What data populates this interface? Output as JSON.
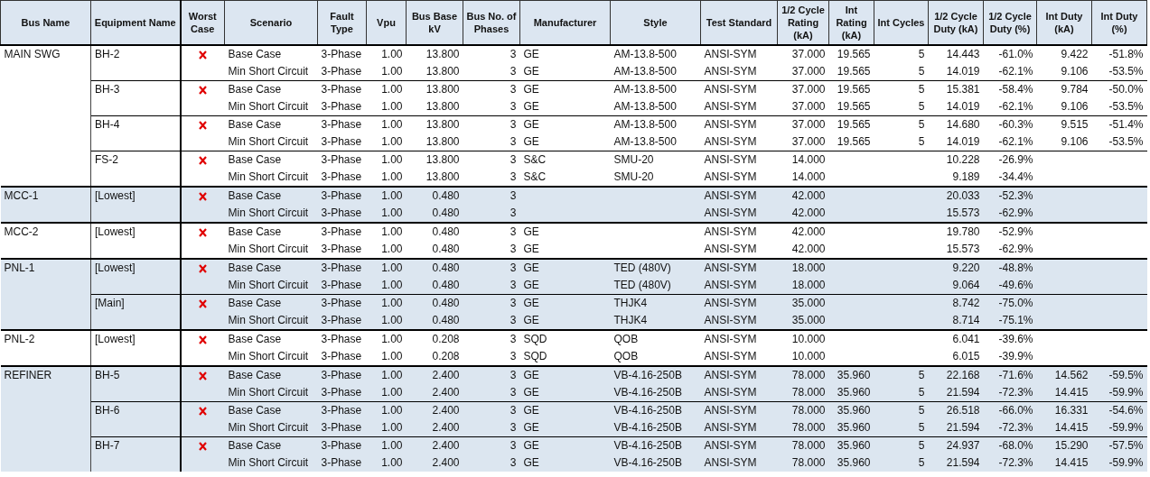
{
  "table": {
    "columns": [
      "Bus Name",
      "Equipment Name",
      "Worst Case",
      "Scenario",
      "Fault Type",
      "Vpu",
      "Bus Base kV",
      "Bus No. of Phases",
      "Manufacturer",
      "Style",
      "Test Standard",
      "1/2 Cycle Rating (kA)",
      "Int Rating (kA)",
      "Int Cycles",
      "1/2 Cycle Duty (kA)",
      "1/2 Cycle Duty (%)",
      "Int Duty (kA)",
      "Int Duty (%)"
    ],
    "buses": [
      {
        "name": "MAIN SWG",
        "equipment": [
          {
            "name": "BH-2",
            "rows": [
              {
                "worst_case": true,
                "scenario": "Base Case",
                "fault_type": "3-Phase",
                "vpu": "1.00",
                "bus_kv": "13.800",
                "phases": "3",
                "manufacturer": "GE",
                "style": "AM-13.8-500",
                "standard": "ANSI-SYM",
                "half_cycle_rating": "37.000",
                "int_rating": "19.565",
                "int_cycles": "5",
                "half_cycle_duty_ka": "14.443",
                "half_cycle_duty_pct": "-61.0%",
                "int_duty_ka": "9.422",
                "int_duty_pct": "-51.8%"
              },
              {
                "worst_case": false,
                "scenario": "Min Short Circuit",
                "fault_type": "3-Phase",
                "vpu": "1.00",
                "bus_kv": "13.800",
                "phases": "3",
                "manufacturer": "GE",
                "style": "AM-13.8-500",
                "standard": "ANSI-SYM",
                "half_cycle_rating": "37.000",
                "int_rating": "19.565",
                "int_cycles": "5",
                "half_cycle_duty_ka": "14.019",
                "half_cycle_duty_pct": "-62.1%",
                "int_duty_ka": "9.106",
                "int_duty_pct": "-53.5%"
              }
            ]
          },
          {
            "name": "BH-3",
            "rows": [
              {
                "worst_case": true,
                "scenario": "Base Case",
                "fault_type": "3-Phase",
                "vpu": "1.00",
                "bus_kv": "13.800",
                "phases": "3",
                "manufacturer": "GE",
                "style": "AM-13.8-500",
                "standard": "ANSI-SYM",
                "half_cycle_rating": "37.000",
                "int_rating": "19.565",
                "int_cycles": "5",
                "half_cycle_duty_ka": "15.381",
                "half_cycle_duty_pct": "-58.4%",
                "int_duty_ka": "9.784",
                "int_duty_pct": "-50.0%"
              },
              {
                "worst_case": false,
                "scenario": "Min Short Circuit",
                "fault_type": "3-Phase",
                "vpu": "1.00",
                "bus_kv": "13.800",
                "phases": "3",
                "manufacturer": "GE",
                "style": "AM-13.8-500",
                "standard": "ANSI-SYM",
                "half_cycle_rating": "37.000",
                "int_rating": "19.565",
                "int_cycles": "5",
                "half_cycle_duty_ka": "14.019",
                "half_cycle_duty_pct": "-62.1%",
                "int_duty_ka": "9.106",
                "int_duty_pct": "-53.5%"
              }
            ]
          },
          {
            "name": "BH-4",
            "rows": [
              {
                "worst_case": true,
                "scenario": "Base Case",
                "fault_type": "3-Phase",
                "vpu": "1.00",
                "bus_kv": "13.800",
                "phases": "3",
                "manufacturer": "GE",
                "style": "AM-13.8-500",
                "standard": "ANSI-SYM",
                "half_cycle_rating": "37.000",
                "int_rating": "19.565",
                "int_cycles": "5",
                "half_cycle_duty_ka": "14.680",
                "half_cycle_duty_pct": "-60.3%",
                "int_duty_ka": "9.515",
                "int_duty_pct": "-51.4%"
              },
              {
                "worst_case": false,
                "scenario": "Min Short Circuit",
                "fault_type": "3-Phase",
                "vpu": "1.00",
                "bus_kv": "13.800",
                "phases": "3",
                "manufacturer": "GE",
                "style": "AM-13.8-500",
                "standard": "ANSI-SYM",
                "half_cycle_rating": "37.000",
                "int_rating": "19.565",
                "int_cycles": "5",
                "half_cycle_duty_ka": "14.019",
                "half_cycle_duty_pct": "-62.1%",
                "int_duty_ka": "9.106",
                "int_duty_pct": "-53.5%"
              }
            ]
          },
          {
            "name": "FS-2",
            "rows": [
              {
                "worst_case": true,
                "scenario": "Base Case",
                "fault_type": "3-Phase",
                "vpu": "1.00",
                "bus_kv": "13.800",
                "phases": "3",
                "manufacturer": "S&C",
                "style": "SMU-20",
                "standard": "ANSI-SYM",
                "half_cycle_rating": "14.000",
                "half_cycle_duty_ka": "10.228",
                "half_cycle_duty_pct": "-26.9%"
              },
              {
                "worst_case": false,
                "scenario": "Min Short Circuit",
                "fault_type": "3-Phase",
                "vpu": "1.00",
                "bus_kv": "13.800",
                "phases": "3",
                "manufacturer": "S&C",
                "style": "SMU-20",
                "standard": "ANSI-SYM",
                "half_cycle_rating": "14.000",
                "half_cycle_duty_ka": "9.189",
                "half_cycle_duty_pct": "-34.4%"
              }
            ]
          }
        ]
      },
      {
        "name": "MCC-1",
        "equipment": [
          {
            "name": "[Lowest]",
            "rows": [
              {
                "worst_case": true,
                "scenario": "Base Case",
                "fault_type": "3-Phase",
                "vpu": "1.00",
                "bus_kv": "0.480",
                "phases": "3",
                "standard": "ANSI-SYM",
                "half_cycle_rating": "42.000",
                "half_cycle_duty_ka": "20.033",
                "half_cycle_duty_pct": "-52.3%"
              },
              {
                "worst_case": false,
                "scenario": "Min Short Circuit",
                "fault_type": "3-Phase",
                "vpu": "1.00",
                "bus_kv": "0.480",
                "phases": "3",
                "standard": "ANSI-SYM",
                "half_cycle_rating": "42.000",
                "half_cycle_duty_ka": "15.573",
                "half_cycle_duty_pct": "-62.9%"
              }
            ]
          }
        ]
      },
      {
        "name": "MCC-2",
        "equipment": [
          {
            "name": "[Lowest]",
            "rows": [
              {
                "worst_case": true,
                "scenario": "Base Case",
                "fault_type": "3-Phase",
                "vpu": "1.00",
                "bus_kv": "0.480",
                "phases": "3",
                "manufacturer": "GE",
                "standard": "ANSI-SYM",
                "half_cycle_rating": "42.000",
                "half_cycle_duty_ka": "19.780",
                "half_cycle_duty_pct": "-52.9%"
              },
              {
                "worst_case": false,
                "scenario": "Min Short Circuit",
                "fault_type": "3-Phase",
                "vpu": "1.00",
                "bus_kv": "0.480",
                "phases": "3",
                "manufacturer": "GE",
                "standard": "ANSI-SYM",
                "half_cycle_rating": "42.000",
                "half_cycle_duty_ka": "15.573",
                "half_cycle_duty_pct": "-62.9%"
              }
            ]
          }
        ]
      },
      {
        "name": "PNL-1",
        "equipment": [
          {
            "name": "[Lowest]",
            "rows": [
              {
                "worst_case": true,
                "scenario": "Base Case",
                "fault_type": "3-Phase",
                "vpu": "1.00",
                "bus_kv": "0.480",
                "phases": "3",
                "manufacturer": "GE",
                "style": "TED (480V)",
                "standard": "ANSI-SYM",
                "half_cycle_rating": "18.000",
                "half_cycle_duty_ka": "9.220",
                "half_cycle_duty_pct": "-48.8%"
              },
              {
                "worst_case": false,
                "scenario": "Min Short Circuit",
                "fault_type": "3-Phase",
                "vpu": "1.00",
                "bus_kv": "0.480",
                "phases": "3",
                "manufacturer": "GE",
                "style": "TED (480V)",
                "standard": "ANSI-SYM",
                "half_cycle_rating": "18.000",
                "half_cycle_duty_ka": "9.064",
                "half_cycle_duty_pct": "-49.6%"
              }
            ]
          },
          {
            "name": "[Main]",
            "rows": [
              {
                "worst_case": true,
                "scenario": "Base Case",
                "fault_type": "3-Phase",
                "vpu": "1.00",
                "bus_kv": "0.480",
                "phases": "3",
                "manufacturer": "GE",
                "style": "THJK4",
                "standard": "ANSI-SYM",
                "half_cycle_rating": "35.000",
                "half_cycle_duty_ka": "8.742",
                "half_cycle_duty_pct": "-75.0%"
              },
              {
                "worst_case": false,
                "scenario": "Min Short Circuit",
                "fault_type": "3-Phase",
                "vpu": "1.00",
                "bus_kv": "0.480",
                "phases": "3",
                "manufacturer": "GE",
                "style": "THJK4",
                "standard": "ANSI-SYM",
                "half_cycle_rating": "35.000",
                "half_cycle_duty_ka": "8.714",
                "half_cycle_duty_pct": "-75.1%"
              }
            ]
          }
        ]
      },
      {
        "name": "PNL-2",
        "equipment": [
          {
            "name": "[Lowest]",
            "rows": [
              {
                "worst_case": true,
                "scenario": "Base Case",
                "fault_type": "3-Phase",
                "vpu": "1.00",
                "bus_kv": "0.208",
                "phases": "3",
                "manufacturer": "SQD",
                "style": "QOB",
                "standard": "ANSI-SYM",
                "half_cycle_rating": "10.000",
                "half_cycle_duty_ka": "6.041",
                "half_cycle_duty_pct": "-39.6%"
              },
              {
                "worst_case": false,
                "scenario": "Min Short Circuit",
                "fault_type": "3-Phase",
                "vpu": "1.00",
                "bus_kv": "0.208",
                "phases": "3",
                "manufacturer": "SQD",
                "style": "QOB",
                "standard": "ANSI-SYM",
                "half_cycle_rating": "10.000",
                "half_cycle_duty_ka": "6.015",
                "half_cycle_duty_pct": "-39.9%"
              }
            ]
          }
        ]
      },
      {
        "name": "REFINER",
        "equipment": [
          {
            "name": "BH-5",
            "rows": [
              {
                "worst_case": true,
                "scenario": "Base Case",
                "fault_type": "3-Phase",
                "vpu": "1.00",
                "bus_kv": "2.400",
                "phases": "3",
                "manufacturer": "GE",
                "style": "VB-4.16-250B",
                "standard": "ANSI-SYM",
                "half_cycle_rating": "78.000",
                "int_rating": "35.960",
                "int_cycles": "5",
                "half_cycle_duty_ka": "22.168",
                "half_cycle_duty_pct": "-71.6%",
                "int_duty_ka": "14.562",
                "int_duty_pct": "-59.5%"
              },
              {
                "worst_case": false,
                "scenario": "Min Short Circuit",
                "fault_type": "3-Phase",
                "vpu": "1.00",
                "bus_kv": "2.400",
                "phases": "3",
                "manufacturer": "GE",
                "style": "VB-4.16-250B",
                "standard": "ANSI-SYM",
                "half_cycle_rating": "78.000",
                "int_rating": "35.960",
                "int_cycles": "5",
                "half_cycle_duty_ka": "21.594",
                "half_cycle_duty_pct": "-72.3%",
                "int_duty_ka": "14.415",
                "int_duty_pct": "-59.9%"
              }
            ]
          },
          {
            "name": "BH-6",
            "rows": [
              {
                "worst_case": true,
                "scenario": "Base Case",
                "fault_type": "3-Phase",
                "vpu": "1.00",
                "bus_kv": "2.400",
                "phases": "3",
                "manufacturer": "GE",
                "style": "VB-4.16-250B",
                "standard": "ANSI-SYM",
                "half_cycle_rating": "78.000",
                "int_rating": "35.960",
                "int_cycles": "5",
                "half_cycle_duty_ka": "26.518",
                "half_cycle_duty_pct": "-66.0%",
                "int_duty_ka": "16.331",
                "int_duty_pct": "-54.6%"
              },
              {
                "worst_case": false,
                "scenario": "Min Short Circuit",
                "fault_type": "3-Phase",
                "vpu": "1.00",
                "bus_kv": "2.400",
                "phases": "3",
                "manufacturer": "GE",
                "style": "VB-4.16-250B",
                "standard": "ANSI-SYM",
                "half_cycle_rating": "78.000",
                "int_rating": "35.960",
                "int_cycles": "5",
                "half_cycle_duty_ka": "21.594",
                "half_cycle_duty_pct": "-72.3%",
                "int_duty_ka": "14.415",
                "int_duty_pct": "-59.9%"
              }
            ]
          },
          {
            "name": "BH-7",
            "rows": [
              {
                "worst_case": true,
                "scenario": "Base Case",
                "fault_type": "3-Phase",
                "vpu": "1.00",
                "bus_kv": "2.400",
                "phases": "3",
                "manufacturer": "GE",
                "style": "VB-4.16-250B",
                "standard": "ANSI-SYM",
                "half_cycle_rating": "78.000",
                "int_rating": "35.960",
                "int_cycles": "5",
                "half_cycle_duty_ka": "24.937",
                "half_cycle_duty_pct": "-68.0%",
                "int_duty_ka": "15.290",
                "int_duty_pct": "-57.5%"
              },
              {
                "worst_case": false,
                "scenario": "Min Short Circuit",
                "fault_type": "3-Phase",
                "vpu": "1.00",
                "bus_kv": "2.400",
                "phases": "3",
                "manufacturer": "GE",
                "style": "VB-4.16-250B",
                "standard": "ANSI-SYM",
                "half_cycle_rating": "78.000",
                "int_rating": "35.960",
                "int_cycles": "5",
                "half_cycle_duty_ka": "21.594",
                "half_cycle_duty_pct": "-72.3%",
                "int_duty_ka": "14.415",
                "int_duty_pct": "-59.9%"
              }
            ]
          }
        ]
      }
    ]
  }
}
